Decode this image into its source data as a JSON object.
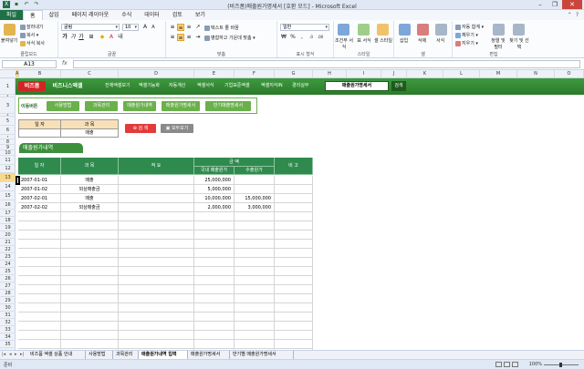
{
  "window": {
    "title": "(비즈폼)매출원가명세서 [호환 모드] - Microsoft Excel",
    "controls": [
      "–",
      "❐",
      "✕"
    ]
  },
  "ribbon": {
    "tabs": [
      "파일",
      "홈",
      "삽입",
      "페이지 레이아웃",
      "수식",
      "데이터",
      "검토",
      "보기"
    ],
    "active_tab": "홈",
    "groups": {
      "clipboard": {
        "label": "클립보드",
        "paste": "붙여넣기",
        "cut": "잘라내기",
        "copy": "복사 ▾",
        "format_painter": "서식 복사"
      },
      "font": {
        "label": "글꼴",
        "font_name": "굴림",
        "font_size": "10"
      },
      "alignment": {
        "label": "맞춤",
        "wrap": "텍스트 줄 바꿈",
        "merge": "병합하고 가운데 맞춤 ▾"
      },
      "number": {
        "label": "표시 형식",
        "format": "일반"
      },
      "styles": {
        "label": "스타일",
        "conditional": "조건부 서식",
        "table": "표 서식",
        "cell": "셀 스타일"
      },
      "cells": {
        "label": "셀",
        "insert": "삽입",
        "delete": "삭제",
        "format": "서식"
      },
      "editing": {
        "label": "편집",
        "autosum": "자동 합계 ▾",
        "fill": "채우기 ▾",
        "clear": "지우기 ▾",
        "sort": "정렬 및 필터",
        "find": "찾기 및 선택"
      }
    }
  },
  "formula_bar": {
    "name_box": "A13",
    "fx": "fx",
    "value": ""
  },
  "columns": [
    "A",
    "B",
    "C",
    "D",
    "E",
    "F",
    "G",
    "H",
    "I",
    "J",
    "K",
    "L",
    "M",
    "N",
    "O"
  ],
  "selected_column": "A",
  "rows": [
    "1",
    "2",
    "3",
    "4",
    "5",
    "6",
    "7",
    "8",
    "9",
    "10",
    "11",
    "12",
    "13",
    "14",
    "15",
    "16",
    "17",
    "18",
    "19",
    "20",
    "21",
    "22",
    "23",
    "24",
    "25",
    "26",
    "27",
    "28",
    "29",
    "30",
    "31",
    "32",
    "33",
    "34",
    "35"
  ],
  "selected_row": "13",
  "nav": {
    "logo_primary": "비즈폼",
    "logo_secondary": "비즈니스엑셀",
    "items": [
      "전체엑셀보기",
      "엑셀기능화",
      "자동계산",
      "엑셀서식",
      "기업표준엑셀",
      "엑셀지식IN",
      "경리실무"
    ],
    "select_value": "매출원가명세서",
    "go_label": "검색"
  },
  "menu": {
    "label": "이동버튼",
    "buttons": [
      "사용방법",
      "과목관리",
      "매출원가내역",
      "매출원가명세서",
      "반기매출명세서"
    ]
  },
  "search": {
    "header_date": "일 자",
    "header_subject": "과 목",
    "value_date": "",
    "value_subject": "매출",
    "search_button": "검 색",
    "show_all_button": "모두보기"
  },
  "section_title": "매출원가내역",
  "table": {
    "headers": {
      "date": "일 자",
      "subject": "과 목",
      "summary": "적 요",
      "amount": "금 액",
      "domestic": "국내 매출원가",
      "export": "수출원가",
      "note": "비 고"
    },
    "rows": [
      {
        "date": "2007-01-01",
        "subject": "매출",
        "summary": "",
        "domestic": "25,000,000",
        "export": "",
        "note": ""
      },
      {
        "date": "2007-01-02",
        "subject": "외상매출금",
        "summary": "",
        "domestic": "5,000,000",
        "export": "",
        "note": ""
      },
      {
        "date": "2007-02-01",
        "subject": "매출",
        "summary": "",
        "domestic": "10,000,000",
        "export": "15,000,000",
        "note": ""
      },
      {
        "date": "2007-02-02",
        "subject": "외상매출금",
        "summary": "",
        "domestic": "2,000,000",
        "export": "3,000,000",
        "note": ""
      }
    ]
  },
  "sheet_tabs": [
    "비즈폼 엑셀 상품 안내",
    "사용방법",
    "과목관리",
    "매출원가내역 입력",
    "매출원가명세서",
    "반기별 매출원가명세서"
  ],
  "active_sheet": "매출원가내역 입력",
  "status": {
    "ready": "준비",
    "zoom": "100%"
  },
  "colors": {
    "nav_green": "#3d9a3d",
    "header_green": "#2f8a4e",
    "menu_green": "#6ab04c",
    "search_red": "#e33b3b",
    "file_tab": "#1e7145"
  }
}
